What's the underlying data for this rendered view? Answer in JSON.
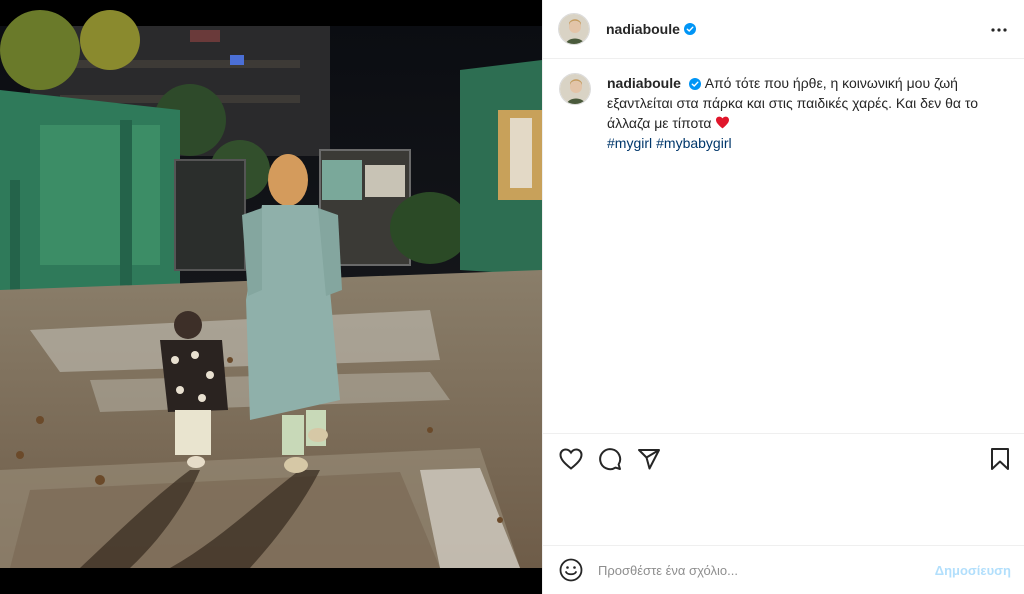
{
  "post": {
    "username": "nadiaboule",
    "verified": true,
    "caption": "Από τότε που ήρθε, η κοινωνική μου ζωή εξαντλείται στα πάρκα και στις παιδικές χαρές. Και δεν θα το άλλαζα με τίποτα",
    "caption_emoji": "heart-emoji",
    "hashtags": [
      "#mygirl",
      "#mybabygirl"
    ]
  },
  "icons": {
    "more": "more-options-icon",
    "like": "heart-icon",
    "comment": "comment-icon",
    "share": "send-icon",
    "save": "bookmark-icon",
    "emoji": "smiley-icon",
    "verified": "verified-badge-icon"
  },
  "comment_box": {
    "placeholder": "Προσθέστε ένα σχόλιο...",
    "post_label": "Δημοσίευση"
  },
  "colors": {
    "verified": "#0095f6",
    "hashtag": "#00376b",
    "post_button_disabled": "#b2dffc",
    "heart": "#ed4956"
  }
}
